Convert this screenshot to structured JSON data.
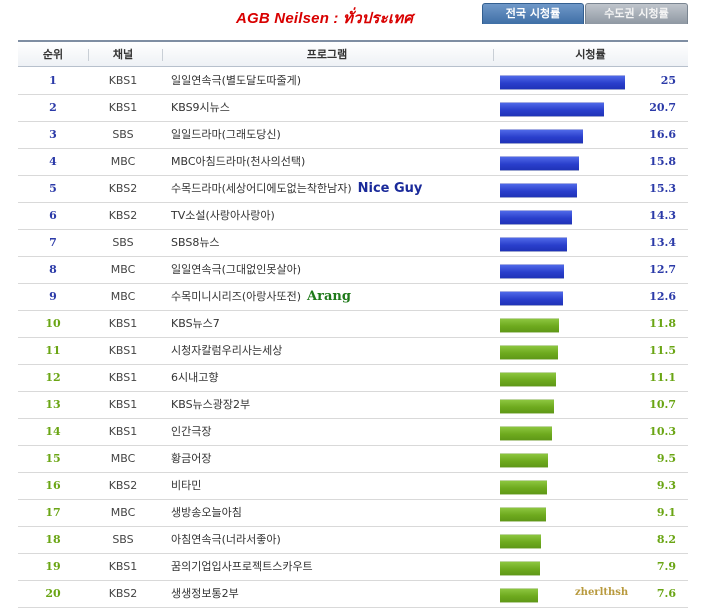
{
  "header": {
    "title": "AGB Neilsen : ทั่วประเทศ"
  },
  "tabs": [
    {
      "label": "전국 시청률",
      "active": true
    },
    {
      "label": "수도권 시청률",
      "active": false
    }
  ],
  "table": {
    "columns": [
      "순위",
      "채널",
      "프로그램",
      "시청률"
    ],
    "max_rating": 25,
    "rows": [
      {
        "rank": "1",
        "channel": "KBS1",
        "program": "일일연속극(별도달도따줄게)",
        "rating": "25",
        "note": ""
      },
      {
        "rank": "2",
        "channel": "KBS1",
        "program": "KBS9시뉴스",
        "rating": "20.7",
        "note": ""
      },
      {
        "rank": "3",
        "channel": "SBS",
        "program": "일일드라마(그래도당신)",
        "rating": "16.6",
        "note": ""
      },
      {
        "rank": "4",
        "channel": "MBC",
        "program": "MBC아침드라마(천사의선택)",
        "rating": "15.8",
        "note": ""
      },
      {
        "rank": "5",
        "channel": "KBS2",
        "program": "수목드라마(세상어디에도없는착한남자)",
        "rating": "15.3",
        "note": "Nice Guy"
      },
      {
        "rank": "6",
        "channel": "KBS2",
        "program": "TV소설(사랑아사랑아)",
        "rating": "14.3",
        "note": ""
      },
      {
        "rank": "7",
        "channel": "SBS",
        "program": "SBS8뉴스",
        "rating": "13.4",
        "note": ""
      },
      {
        "rank": "8",
        "channel": "MBC",
        "program": "일일연속극(그대없인못살아)",
        "rating": "12.7",
        "note": ""
      },
      {
        "rank": "9",
        "channel": "MBC",
        "program": "수목미니시리즈(아랑사또전)",
        "rating": "12.6",
        "note": "Arang"
      },
      {
        "rank": "10",
        "channel": "KBS1",
        "program": "KBS뉴스7",
        "rating": "11.8",
        "note": ""
      },
      {
        "rank": "11",
        "channel": "KBS1",
        "program": "시청자칼럼우리사는세상",
        "rating": "11.5",
        "note": ""
      },
      {
        "rank": "12",
        "channel": "KBS1",
        "program": "6시내고향",
        "rating": "11.1",
        "note": ""
      },
      {
        "rank": "13",
        "channel": "KBS1",
        "program": "KBS뉴스광장2부",
        "rating": "10.7",
        "note": ""
      },
      {
        "rank": "14",
        "channel": "KBS1",
        "program": "인간극장",
        "rating": "10.3",
        "note": ""
      },
      {
        "rank": "15",
        "channel": "MBC",
        "program": "황금어장",
        "rating": "9.5",
        "note": ""
      },
      {
        "rank": "16",
        "channel": "KBS2",
        "program": "비타민",
        "rating": "9.3",
        "note": ""
      },
      {
        "rank": "17",
        "channel": "MBC",
        "program": "생방송오늘아침",
        "rating": "9.1",
        "note": ""
      },
      {
        "rank": "18",
        "channel": "SBS",
        "program": "아침연속극(너라서좋아)",
        "rating": "8.2",
        "note": ""
      },
      {
        "rank": "19",
        "channel": "KBS1",
        "program": "꿈의기업입사프로젝트스카우트",
        "rating": "7.9",
        "note": ""
      },
      {
        "rank": "20",
        "channel": "KBS2",
        "program": "생생정보통2부",
        "rating": "7.6",
        "note": ""
      }
    ]
  },
  "watermark": "zherlthsh",
  "colors": {
    "top_bar": "#2a3fcc",
    "other_bar": "#6eaa1e",
    "note_nice_guy": "#1a2a9a",
    "note_arang": "#1f7a1a",
    "title": "#d80000"
  }
}
